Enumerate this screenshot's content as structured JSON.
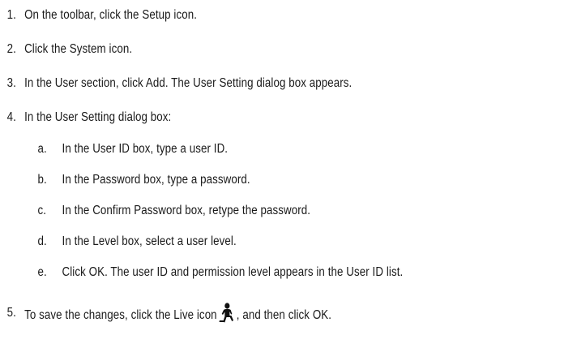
{
  "steps": [
    {
      "num": "1.",
      "text": "On the toolbar, click the Setup icon."
    },
    {
      "num": "2.",
      "text": "Click the System icon."
    },
    {
      "num": "3.",
      "text": "In the User section, click Add. The User Setting dialog box appears."
    },
    {
      "num": "4.",
      "text": "In the User Setting dialog box:"
    }
  ],
  "substeps": [
    {
      "num": "a.",
      "text": "In the User ID box, type a user ID."
    },
    {
      "num": "b.",
      "text": "In the Password box, type a password."
    },
    {
      "num": "c.",
      "text": "In the Confirm Password box, retype the password."
    },
    {
      "num": "d.",
      "text": "In the Level box, select a user level."
    },
    {
      "num": "e.",
      "text": "Click OK. The user ID and permission level appears in the User ID list."
    }
  ],
  "final_step": {
    "num": "5.",
    "text_before": "To save the changes, click the Live icon",
    "icon": "live-icon",
    "text_after": ", and then click OK."
  }
}
